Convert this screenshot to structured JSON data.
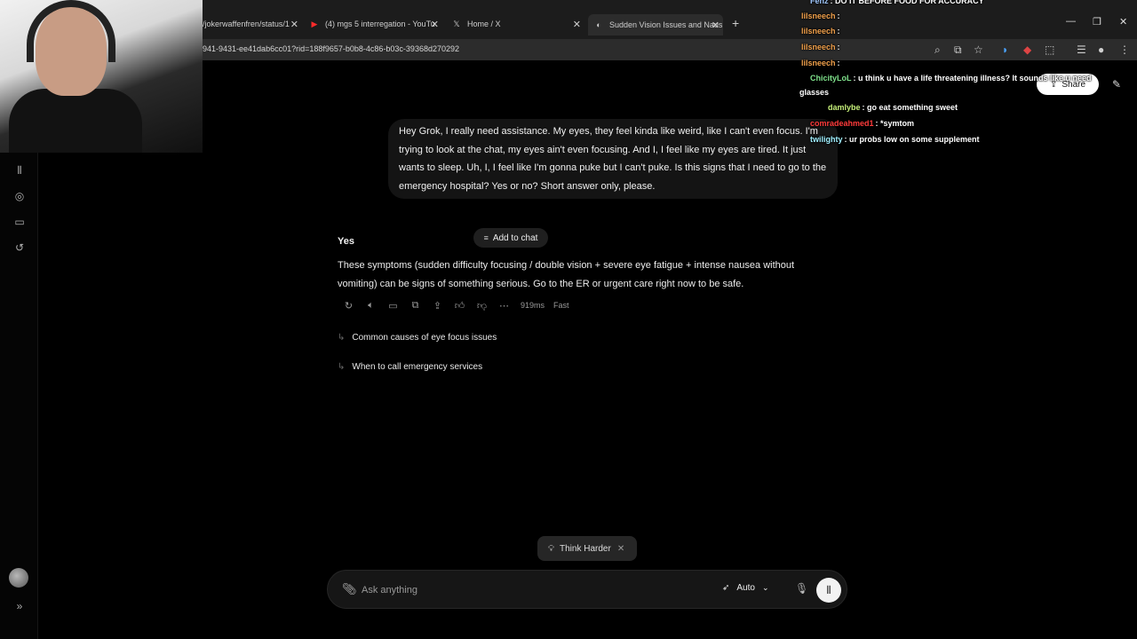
{
  "browser": {
    "tabs": [
      {
        "label": "/jokerwaffenfren/status/1",
        "icon": "x-icon"
      },
      {
        "label": "(4) mgs 5 interregation - YouTu",
        "icon": "youtube-icon"
      },
      {
        "label": "Home / X",
        "icon": "x-icon"
      },
      {
        "label": "Sudden Vision Issues and Naus",
        "icon": "grok-icon"
      }
    ],
    "url": "941-9431-ee41dab6cc01?rid=188f9657-b0b8-4c86-b03c-39368d270292"
  },
  "conversation": {
    "user_message": "Hey Grok, I really need assistance. My eyes, they feel kinda like weird, like I can't even focus. I'm trying to look at the chat, my eyes ain't even focusing. And I, I feel like my eyes are tired. It just wants to sleep. Uh, I, I feel like I'm gonna puke but I can't puke. Is this signs that I need to go to the emergency hospital? Yes or no? Short answer only, please.",
    "add_to_chat_label": "Add to chat",
    "answer_title": "Yes",
    "answer_body": "These symptoms (sudden difficulty focusing / double vision + severe eye fatigue + intense nausea without vomiting) can be signs of something serious. Go to the ER or urgent care right now to be safe.",
    "response_time": "919ms",
    "speed_label": "Fast",
    "suggestions": [
      "Common causes of eye focus issues",
      "When to call emergency services"
    ]
  },
  "composer": {
    "think_harder_label": "Think Harder",
    "placeholder": "Ask anything",
    "model_label": "Auto"
  },
  "header": {
    "share_label": "Share"
  },
  "stream_chat": [
    {
      "name": "Fenz",
      "text": ": DO IT BEFORE FOOD FOR ACCURACY",
      "color": "#a0c8ff"
    },
    {
      "name": "lilsneech",
      "text": ":",
      "color": "#f0a04b"
    },
    {
      "name": "lilsneech",
      "text": ":",
      "color": "#f0a04b"
    },
    {
      "name": "lilsneech",
      "text": ":",
      "color": "#f0a04b"
    },
    {
      "name": "lilsneech",
      "text": ":",
      "color": "#f0a04b"
    },
    {
      "name": "ChicityLoL",
      "text": ": u think u have a life threatening illness? It sounds like u need",
      "color": "#7ee08a"
    },
    {
      "name": "",
      "text": "glasses",
      "color": "#ffffff"
    },
    {
      "name": "damlybe",
      "text": ": go eat something sweet",
      "color": "#c6f07a"
    },
    {
      "name": "comradeahmed1",
      "text": ": *symtom",
      "color": "#ff3b3b"
    },
    {
      "name": "twilighty",
      "text": ": ur probs low on some supplement",
      "color": "#a0f0ff"
    }
  ]
}
